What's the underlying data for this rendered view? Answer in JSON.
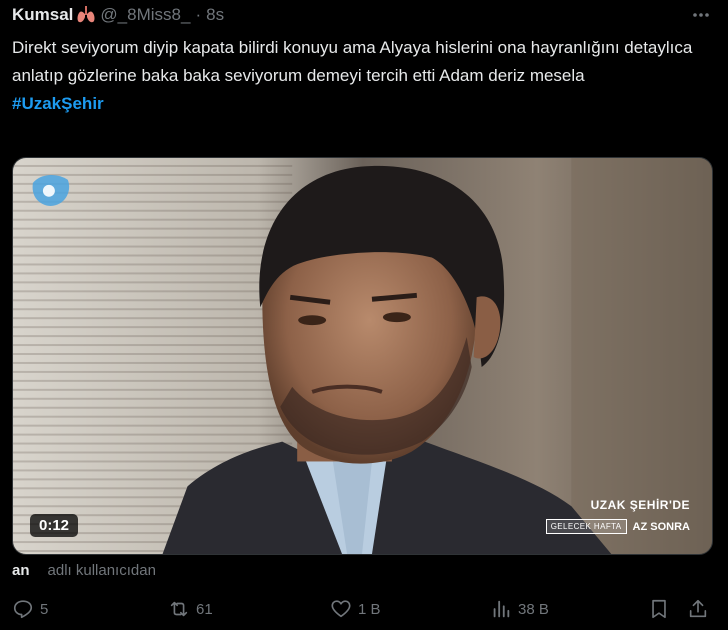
{
  "author": {
    "name": "Kumsal",
    "handle": "@_8Miss8_",
    "separator": "·",
    "time": "8s",
    "emoji_icon": "lungs-icon"
  },
  "post": {
    "text": "Direkt seviyorum diyip kapata bilirdi konuyu ama Alyaya hislerini ona hayranlığını detaylıca anlatıp gözlerine baka baka seviyorum demeyi tercih etti Adam deriz mesela",
    "hashtag": "#UzakŞehir"
  },
  "media": {
    "duration": "0:12",
    "overlay_title": "UZAK ŞEHİR'DE",
    "overlay_next": "GELECEK HAFTA",
    "overlay_soon": "AZ SONRA"
  },
  "quote_info": {
    "user": "an",
    "label": "adlı kullanıcıdan"
  },
  "actions": {
    "replies": "5",
    "reposts": "61",
    "likes": "1 B",
    "views": "38 B"
  },
  "colors": {
    "background": "#000000",
    "text": "#e7e9ea",
    "muted": "#71767b",
    "link": "#1d9bf0"
  }
}
